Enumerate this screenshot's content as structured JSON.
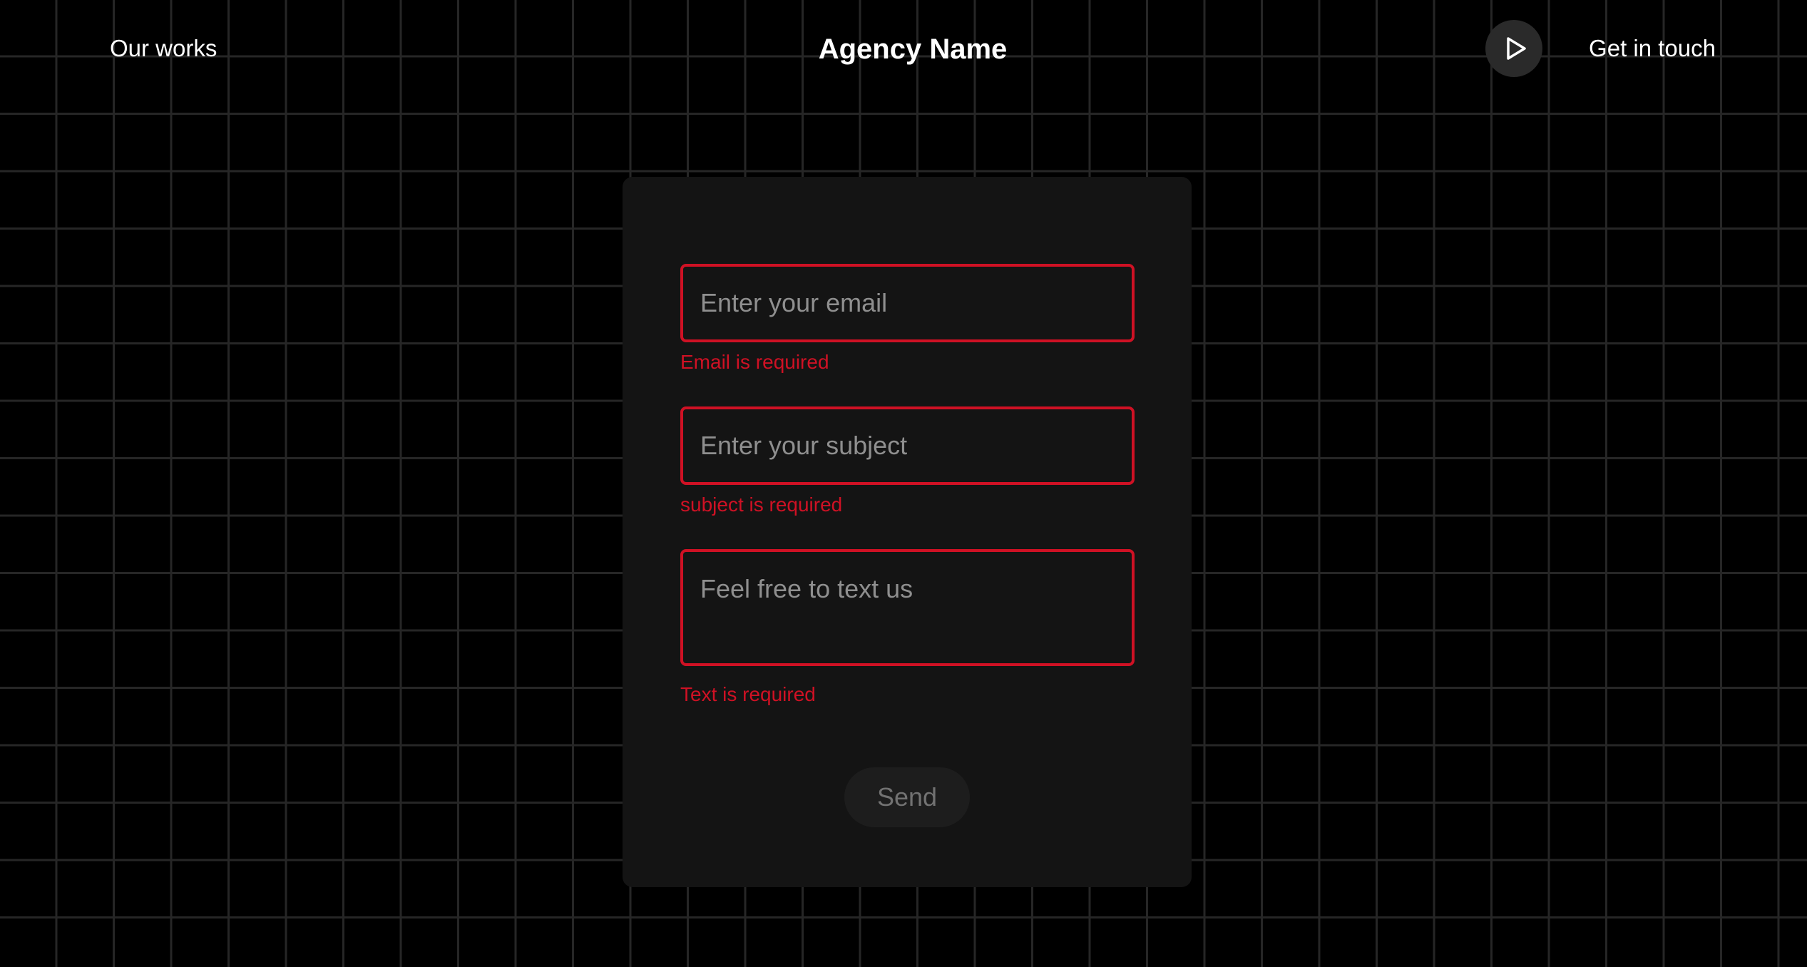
{
  "header": {
    "nav_left_label": "Our works",
    "brand": "Agency Name",
    "nav_right_label": "Get in touch",
    "play_icon": "play-icon"
  },
  "form": {
    "email": {
      "value": "",
      "placeholder": "Enter your email",
      "error": "Email is required"
    },
    "subject": {
      "value": "",
      "placeholder": "Enter your subject",
      "error": "subject is required"
    },
    "text": {
      "value": "",
      "placeholder": "Feel free to text us",
      "error": "Text is required"
    },
    "send_label": "Send"
  },
  "colors": {
    "background": "#000000",
    "grid_line": "#262626",
    "card": "#141414",
    "error": "#cf1124",
    "play_button": "#2a2a2a",
    "send_button": "#1d1d1d"
  }
}
